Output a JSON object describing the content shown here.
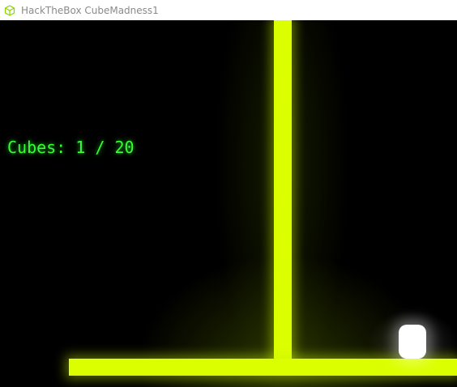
{
  "window": {
    "title": "HackTheBox CubeMadness1",
    "icon": "cube-icon"
  },
  "hud": {
    "cubes_text": "Cubes: 1 / 20",
    "cubes_collected": 1,
    "cubes_total": 20
  },
  "colors": {
    "background": "#000000",
    "wall": "#dcff00",
    "hud_text": "#33ff33",
    "player": "#ffffff",
    "icon_accent": "#8bd400"
  }
}
